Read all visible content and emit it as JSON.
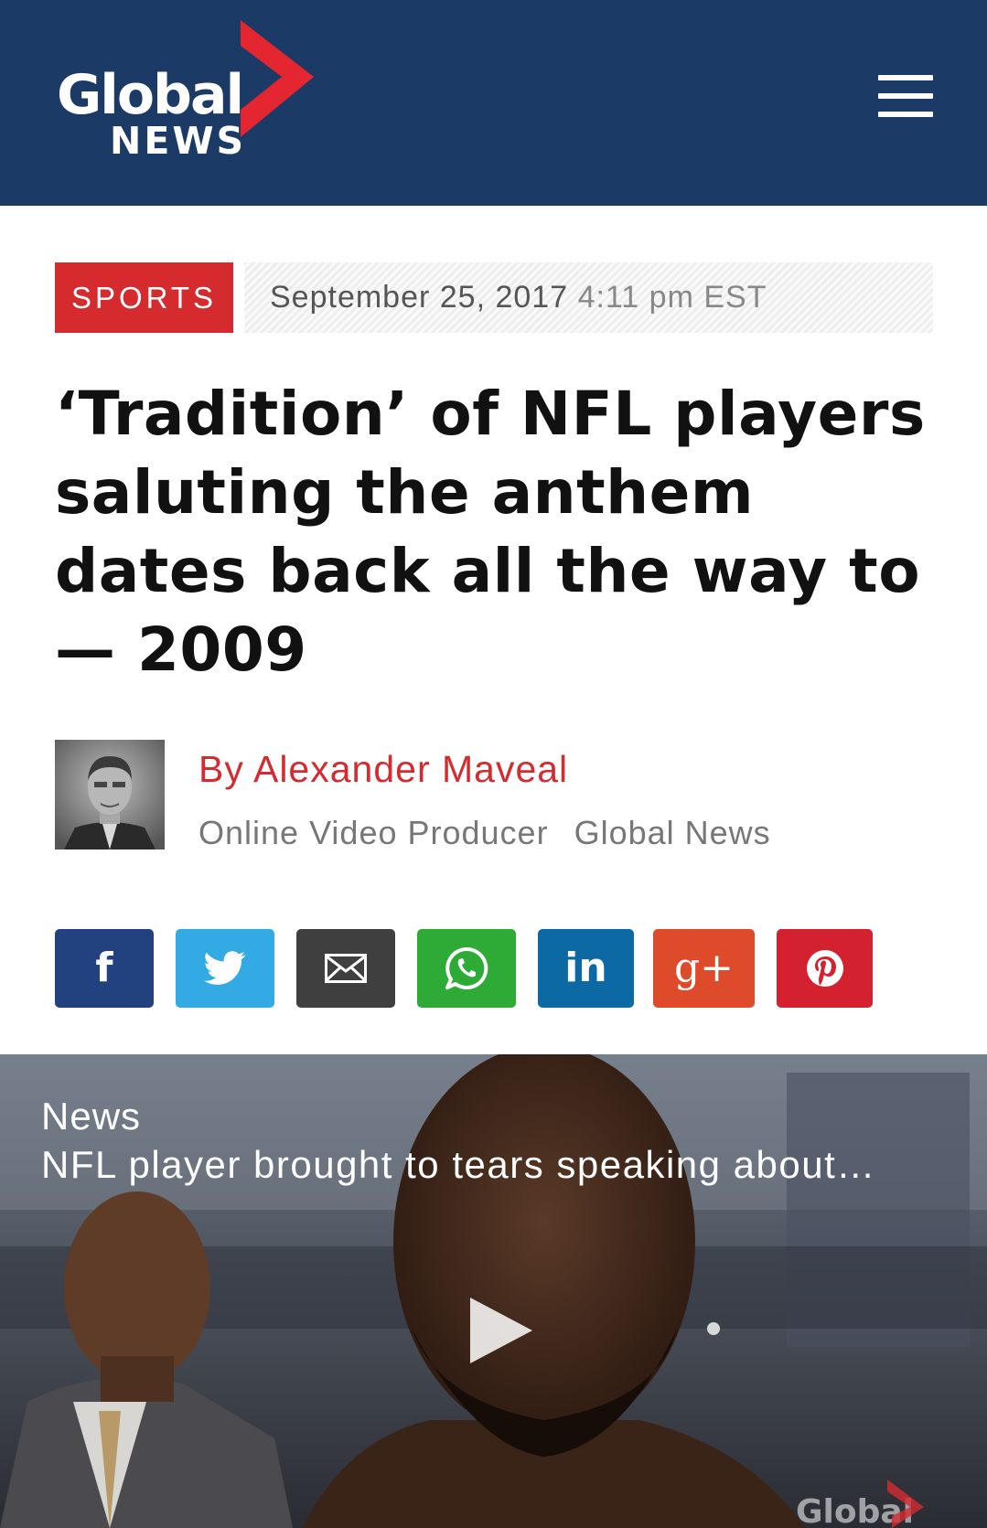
{
  "header": {
    "logo_line1": "Global",
    "logo_line2": "NEWS",
    "menu_icon": "hamburger-menu-icon"
  },
  "article": {
    "category": "SPORTS",
    "date": "September 25, 2017",
    "time": "4:11 pm EST",
    "headline": "‘Tradition’ of NFL players saluting the anthem dates back all the way to — 2009"
  },
  "author": {
    "name": "By Alexander Maveal",
    "role": "Online Video Producer",
    "organization": "Global News"
  },
  "share": {
    "buttons": [
      {
        "network": "Facebook",
        "icon": "facebook-icon",
        "glyph": "f",
        "color": "#21427f"
      },
      {
        "network": "Twitter",
        "icon": "twitter-icon",
        "color": "#33aae4"
      },
      {
        "network": "Email",
        "icon": "email-icon",
        "color": "#3f3f3f"
      },
      {
        "network": "WhatsApp",
        "icon": "whatsapp-icon",
        "color": "#2eaa37"
      },
      {
        "network": "LinkedIn",
        "icon": "linkedin-icon",
        "glyph": "in",
        "color": "#0d69a3"
      },
      {
        "network": "Google+",
        "icon": "google-plus-icon",
        "glyph": "g+",
        "color": "#de4b2b"
      },
      {
        "network": "Pinterest",
        "icon": "pinterest-icon",
        "color": "#d4212f"
      }
    ]
  },
  "video": {
    "category": "News",
    "title": "NFL player brought to tears speaking about…",
    "play_icon": "play-icon"
  },
  "colors": {
    "header_bg": "#1b3a66",
    "accent_red": "#d52b2f"
  }
}
